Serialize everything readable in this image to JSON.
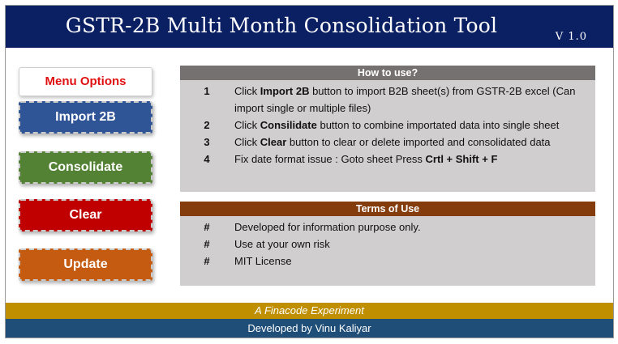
{
  "header": {
    "title": "GSTR-2B Multi Month Consolidation Tool",
    "version": "V 1.0"
  },
  "menu": {
    "title": "Menu Options",
    "buttons": {
      "import": "Import 2B",
      "consolidate": "Consolidate",
      "clear": "Clear",
      "update": "Update"
    }
  },
  "how_to": {
    "heading": "How to use?",
    "steps": [
      {
        "num": "1",
        "pre": "Click ",
        "bold": "Import 2B",
        "post": " button to import B2B sheet(s) from GSTR-2B excel (Can import single or multiple files)"
      },
      {
        "num": "2",
        "pre": "Click ",
        "bold": "Consilidate",
        "post": " button to combine importated data into single sheet"
      },
      {
        "num": "3",
        "pre": "Click ",
        "bold": "Clear",
        "post": " button to clear or delete imported and consolidated data"
      },
      {
        "num": "4",
        "pre": "Fix date format issue : Goto sheet Press ",
        "bold": "Crtl + Shift + F",
        "post": ""
      }
    ]
  },
  "terms": {
    "heading": "Terms of Use",
    "items": [
      {
        "num": "#",
        "text": "Developed for information purpose only."
      },
      {
        "num": "#",
        "text": "Use at your own risk"
      },
      {
        "num": "#",
        "text": "MIT License"
      }
    ]
  },
  "footer": {
    "tagline": "A Finacode Experiment",
    "credit": "Developed by Vinu Kaliyar"
  },
  "colors": {
    "header_bg": "#0b1f63",
    "import": "#2f5597",
    "consolidate": "#548235",
    "clear": "#c00000",
    "update": "#c55a11",
    "howto_head": "#767171",
    "terms_head": "#843c0c",
    "footer_gold": "#bf8f00",
    "footer_blue": "#1f4e79"
  }
}
